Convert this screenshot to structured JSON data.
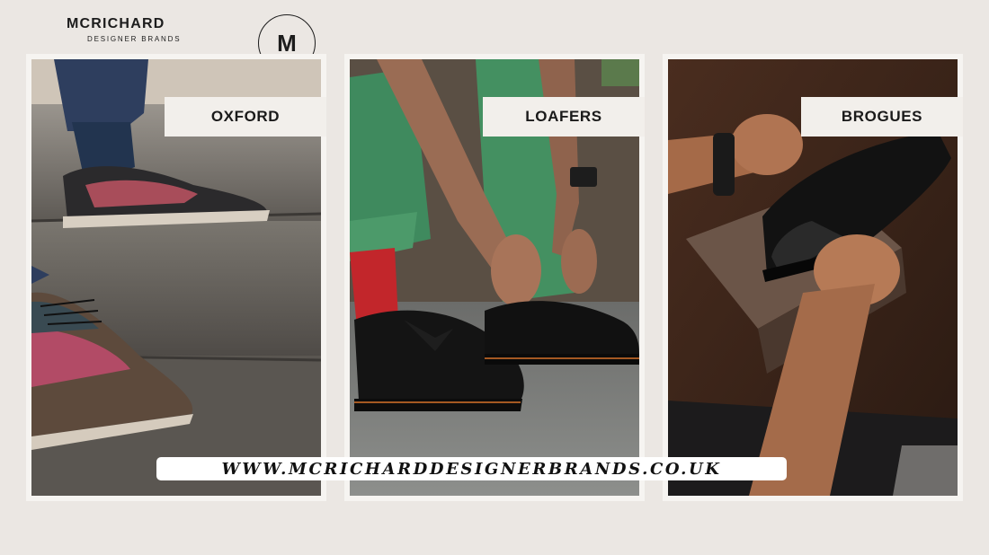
{
  "brand": {
    "name": "MCRICHARD",
    "tagline": "DESIGNER BRANDS",
    "monogram": "M"
  },
  "cards": [
    {
      "label": "OXFORD"
    },
    {
      "label": "LOAFERS"
    },
    {
      "label": "BROGUES"
    }
  ],
  "website": {
    "url": "WWW.MCRICHARDDESIGNERBRANDS.CO.UK"
  },
  "colors": {
    "background": "#ebe7e3",
    "card": "#f6f4f1",
    "text": "#1a1a1a"
  }
}
